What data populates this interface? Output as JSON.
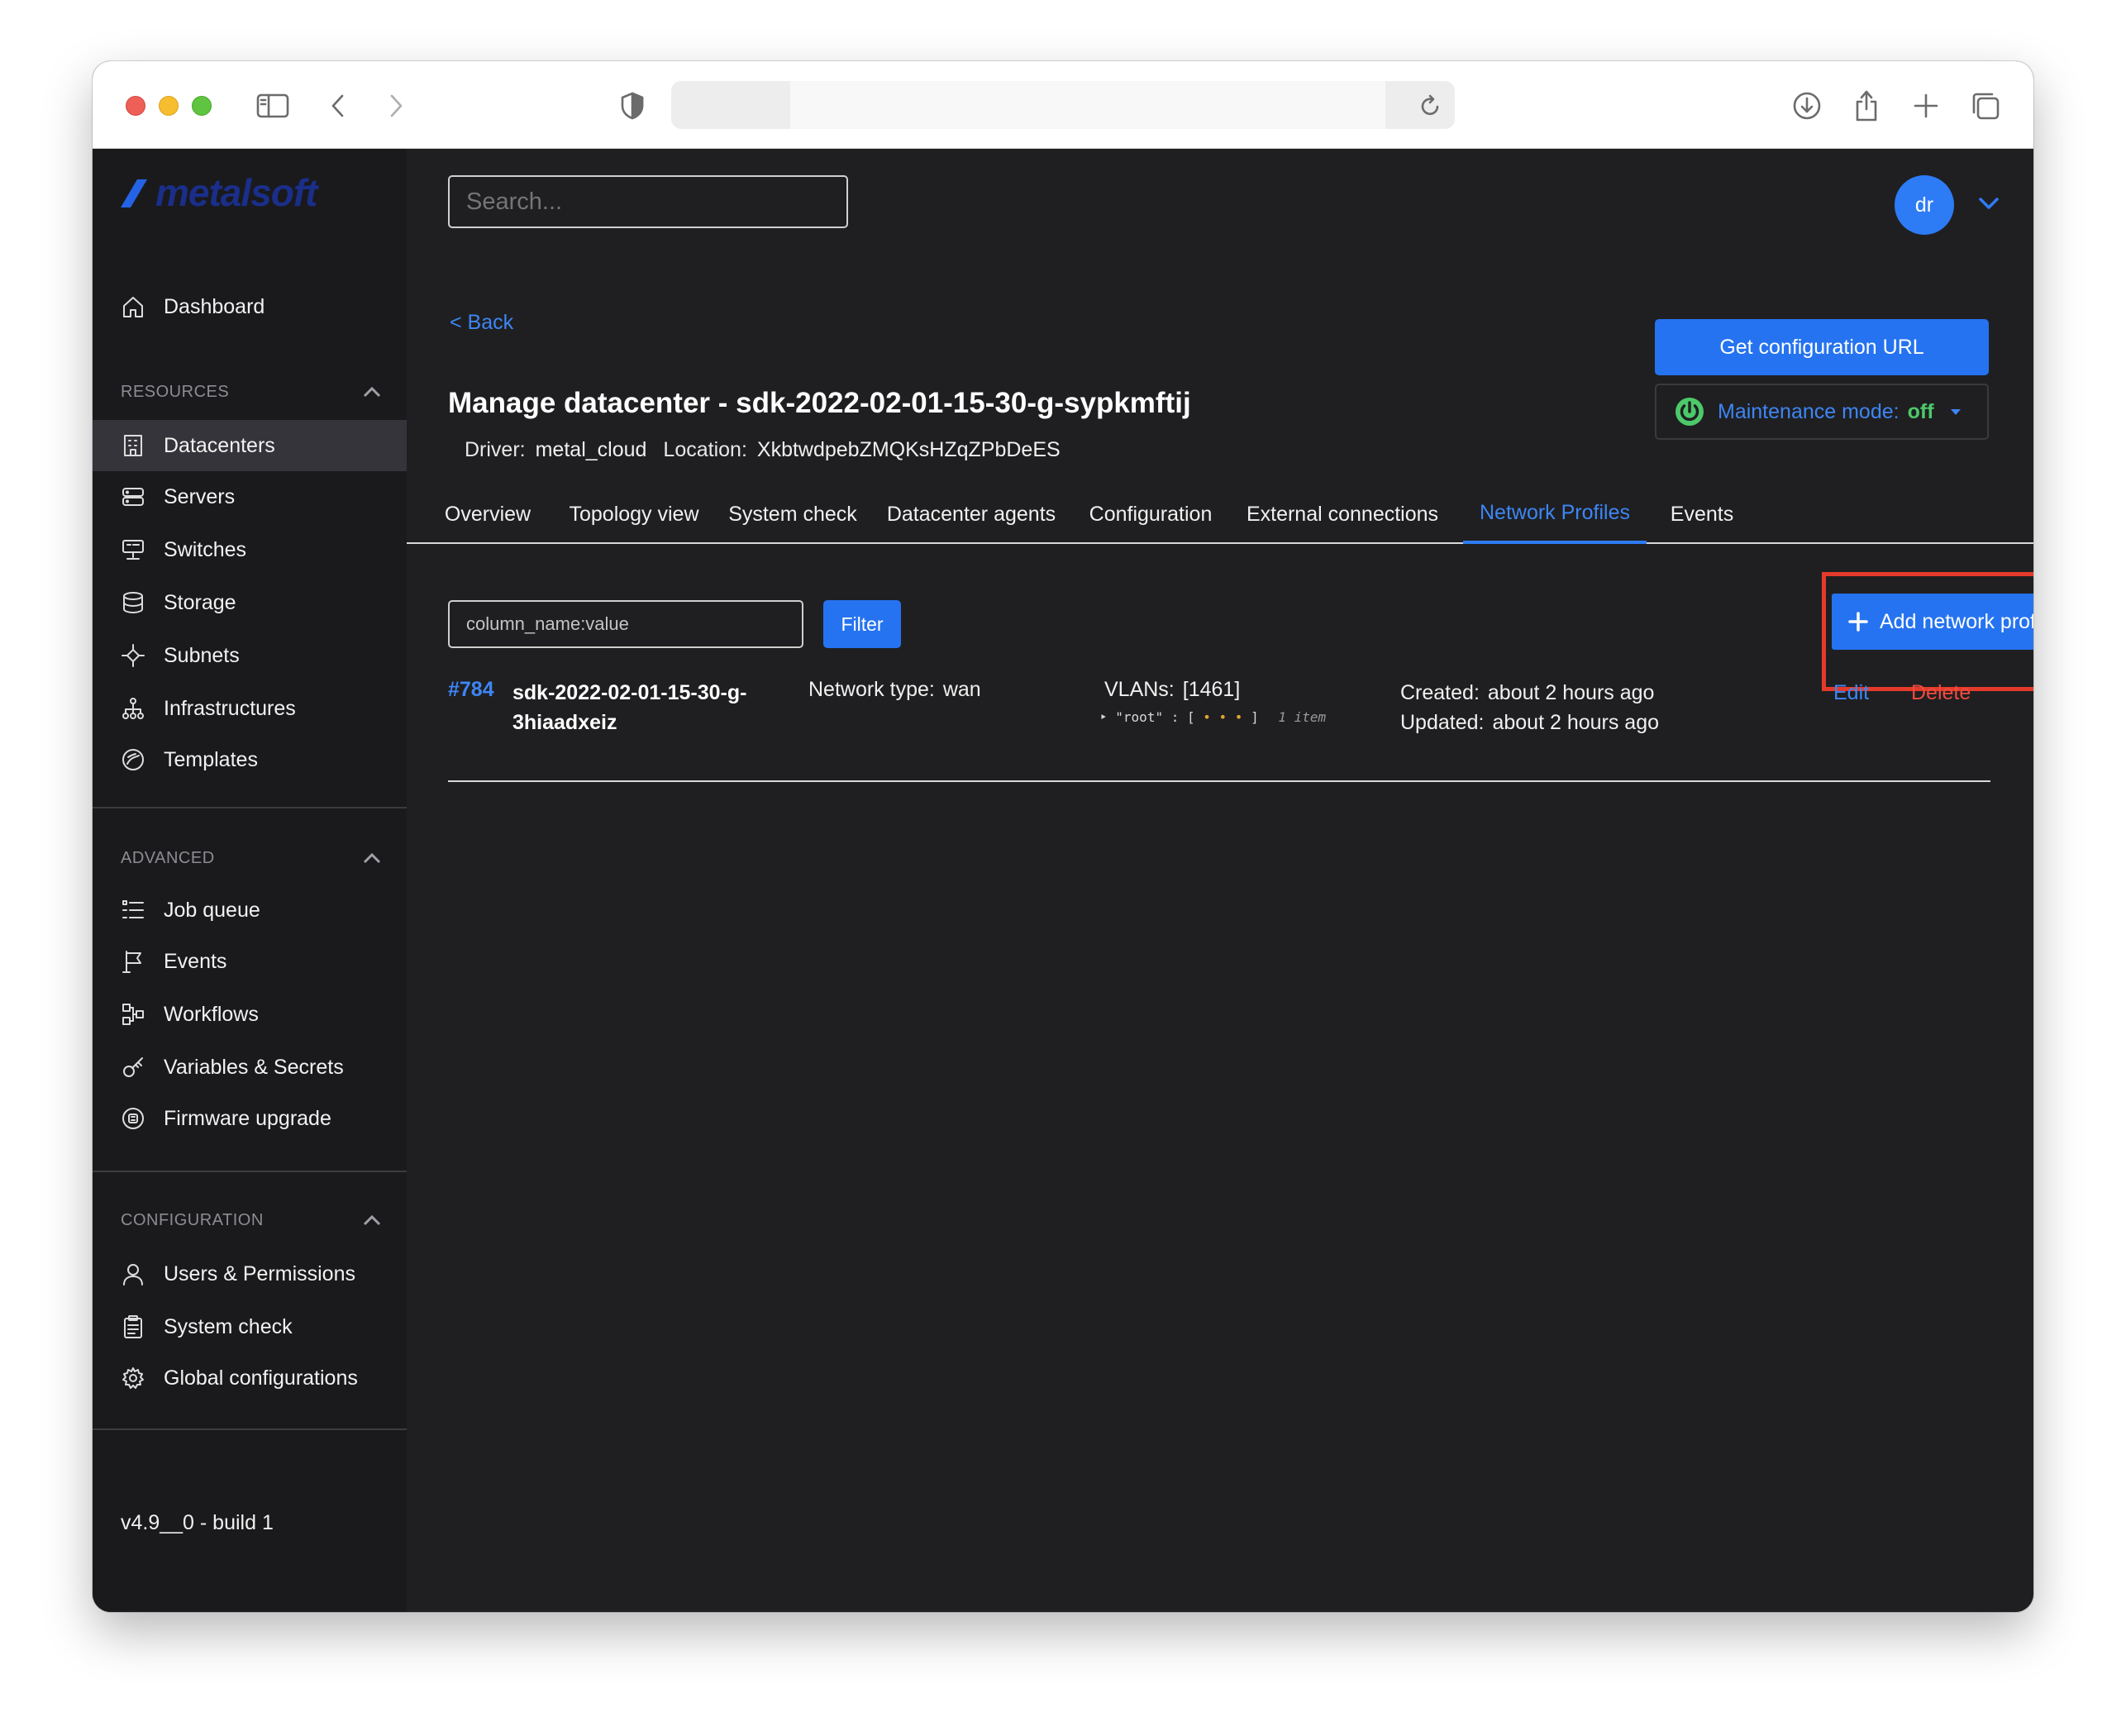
{
  "browser": {
    "url": ""
  },
  "sidebar": {
    "logo": "metalsoft",
    "top_items": [
      {
        "label": "Dashboard",
        "icon": "home-icon"
      }
    ],
    "resources": {
      "title": "RESOURCES",
      "items": [
        {
          "label": "Datacenters",
          "icon": "building-icon",
          "active": true
        },
        {
          "label": "Servers",
          "icon": "server-icon"
        },
        {
          "label": "Switches",
          "icon": "switch-icon"
        },
        {
          "label": "Storage",
          "icon": "database-icon"
        },
        {
          "label": "Subnets",
          "icon": "subnet-icon"
        },
        {
          "label": "Infrastructures",
          "icon": "hierarchy-icon"
        },
        {
          "label": "Templates",
          "icon": "template-icon"
        }
      ]
    },
    "advanced": {
      "title": "ADVANCED",
      "items": [
        {
          "label": "Job queue",
          "icon": "list-icon"
        },
        {
          "label": "Events",
          "icon": "flag-icon"
        },
        {
          "label": "Workflows",
          "icon": "workflow-icon"
        },
        {
          "label": "Variables & Secrets",
          "icon": "key-icon"
        },
        {
          "label": "Firmware upgrade",
          "icon": "firmware-icon"
        }
      ]
    },
    "configuration": {
      "title": "CONFIGURATION",
      "items": [
        {
          "label": "Users & Permissions",
          "icon": "user-icon"
        },
        {
          "label": "System check",
          "icon": "clipboard-icon"
        },
        {
          "label": "Global configurations",
          "icon": "gear-icon"
        }
      ]
    },
    "version": "v4.9__0 - build 1"
  },
  "header": {
    "search_placeholder": "Search...",
    "avatar_initials": "dr"
  },
  "page": {
    "back_label": "< Back",
    "title": "Manage datacenter - sdk-2022-02-01-15-30-g-sypkmftij",
    "driver_label": "Driver:",
    "driver_value": "metal_cloud",
    "location_label": "Location:",
    "location_value": "XkbtwdpebZMQKsHZqZPbDeES",
    "config_button": "Get configuration URL",
    "maintenance_label": "Maintenance mode:",
    "maintenance_state": "off"
  },
  "tabs": [
    {
      "label": "Overview"
    },
    {
      "label": "Topology view"
    },
    {
      "label": "System check"
    },
    {
      "label": "Datacenter agents"
    },
    {
      "label": "Configuration"
    },
    {
      "label": "External connections"
    },
    {
      "label": "Network Profiles",
      "active": true
    },
    {
      "label": "Events"
    }
  ],
  "network_profiles": {
    "filter_placeholder": "column_name:value",
    "filter_button": "Filter",
    "add_button": "Add network profile",
    "rows": [
      {
        "id": "#784",
        "name": "sdk-2022-02-01-15-30-g-3hiaadxeiz",
        "network_type_label": "Network type:",
        "network_type": "wan",
        "vlans_label": "VLANs:",
        "vlans": "[1461]",
        "json_key": "\"root\" : [",
        "json_dots": "• • •",
        "json_close": "]",
        "json_count": "1 item",
        "created_label": "Created:",
        "created": "about 2 hours ago",
        "updated_label": "Updated:",
        "updated": "about 2 hours ago",
        "edit_label": "Edit",
        "delete_label": "Delete"
      }
    ]
  },
  "colors": {
    "accent": "#2573f0",
    "link": "#3d86f5",
    "danger": "#ee4b3e",
    "success": "#4cc96a",
    "highlight": "#e53a2b",
    "background": "#1f1f21",
    "sidebar": "#1a1a1c"
  }
}
